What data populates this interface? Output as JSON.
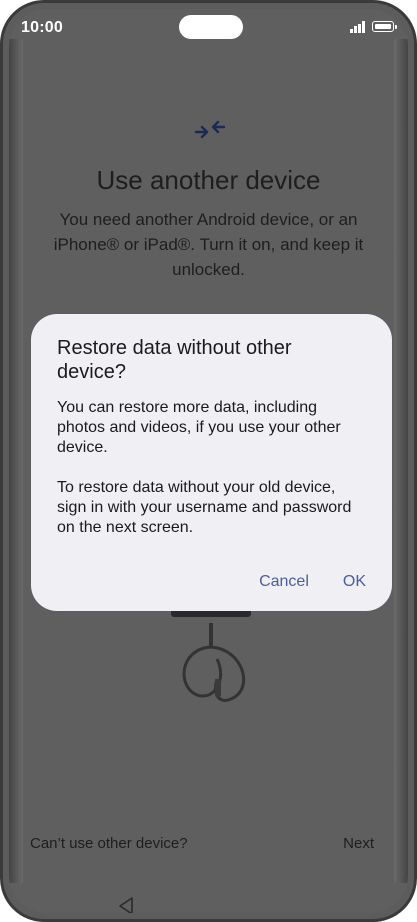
{
  "statusbar": {
    "time": "10:00"
  },
  "background": {
    "title": "Use another device",
    "description": "You need another Android device, or an iPhone® or iPad®. Turn it on, and keep it unlocked.",
    "footer": {
      "left_label": "Can’t use other device?",
      "right_label": "Next"
    }
  },
  "dialog": {
    "title": "Restore data without other device?",
    "paragraph1": "You can restore more data, including photos and videos, if you use your other device.",
    "paragraph2": "To restore data without your old device, sign in with your username and password on the next screen.",
    "cancel_label": "Cancel",
    "ok_label": "OK"
  },
  "icons": {
    "swap": "swap-arrows-icon",
    "cable": "usb-cable-icon",
    "nav_back": "back-triangle-icon"
  },
  "colors": {
    "scrim": "#5f5f5f",
    "dialog_bg": "#f0eff4",
    "accent": "#4a5da0"
  }
}
